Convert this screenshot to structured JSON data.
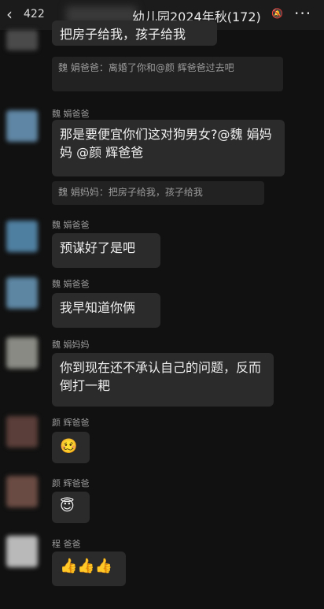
{
  "header": {
    "unread_count": "422",
    "group_title": "幼儿园2024年秋",
    "member_count": "(172)",
    "back_icon": "chevron-left-icon",
    "more_icon": "more-icon",
    "mute_icon": "bell-off-icon"
  },
  "messages": [
    {
      "text": "把房子给我，孩子给我"
    },
    {
      "text": "魏 娟爸爸：离婚了你和@颜 辉爸爸过去吧"
    },
    {
      "sender": "魏 娟爸爸",
      "text": "那是要便宜你们这对狗男女?@魏 娟妈妈 @颜 辉爸爸",
      "quote": "魏 娟妈妈：把房子给我，孩子给我"
    },
    {
      "sender": "魏 娟爸爸",
      "text": "预谋好了是吧"
    },
    {
      "sender": "魏 娟爸爸",
      "text": "我早知道你俩"
    },
    {
      "sender": "魏 娟妈妈",
      "text": "你到现在还不承认自己的问题，反而倒打一耙"
    },
    {
      "sender": "颜 辉爸爸",
      "text": "🥴"
    },
    {
      "sender": "颜 辉爸爸",
      "text": "😇"
    },
    {
      "sender": "程 爸爸",
      "text": "👍👍👍"
    }
  ]
}
